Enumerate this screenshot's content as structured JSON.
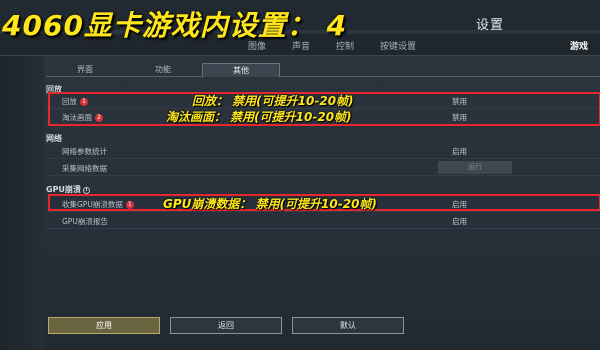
{
  "overlay": {
    "title": "4060显卡游戏内设置： 4"
  },
  "window": {
    "title": "设置"
  },
  "top_tabs": [
    {
      "label": "图像"
    },
    {
      "label": "声音"
    },
    {
      "label": "控制"
    },
    {
      "label": "按键设置"
    },
    {
      "label": "游戏"
    }
  ],
  "sub_tabs": [
    {
      "label": "界面"
    },
    {
      "label": "功能"
    },
    {
      "label": "其他"
    }
  ],
  "sections": {
    "replay": {
      "header": "回放",
      "rows": [
        {
          "label": "回放",
          "badge": "1",
          "value": "禁用"
        },
        {
          "label": "淘汰画面",
          "badge": "2",
          "value": "禁用"
        }
      ]
    },
    "network": {
      "header": "网络",
      "rows": [
        {
          "label": "网络参数统计",
          "value": "启用"
        },
        {
          "label": "采集网络数据",
          "button": "运行"
        }
      ]
    },
    "gpu_crash": {
      "header": "GPU崩溃",
      "info_icon": "i",
      "rows": [
        {
          "label": "收集GPU崩溃数据",
          "badge": "1",
          "value": "启用"
        },
        {
          "label": "GPU崩溃报告",
          "value": "启用"
        }
      ]
    }
  },
  "annotations": {
    "replay": "回放： 禁用(可提升10-20帧)",
    "elimination": "淘汰画面： 禁用(可提升10-20帧)",
    "gpu_crash": "GPU崩溃数据： 禁用(可提升10-20帧)"
  },
  "footer": {
    "apply": "应用",
    "back": "返回",
    "default": "默认"
  },
  "colors": {
    "highlight": "#e8262d",
    "annotation": "#ffe61a",
    "background": "#262e35"
  }
}
